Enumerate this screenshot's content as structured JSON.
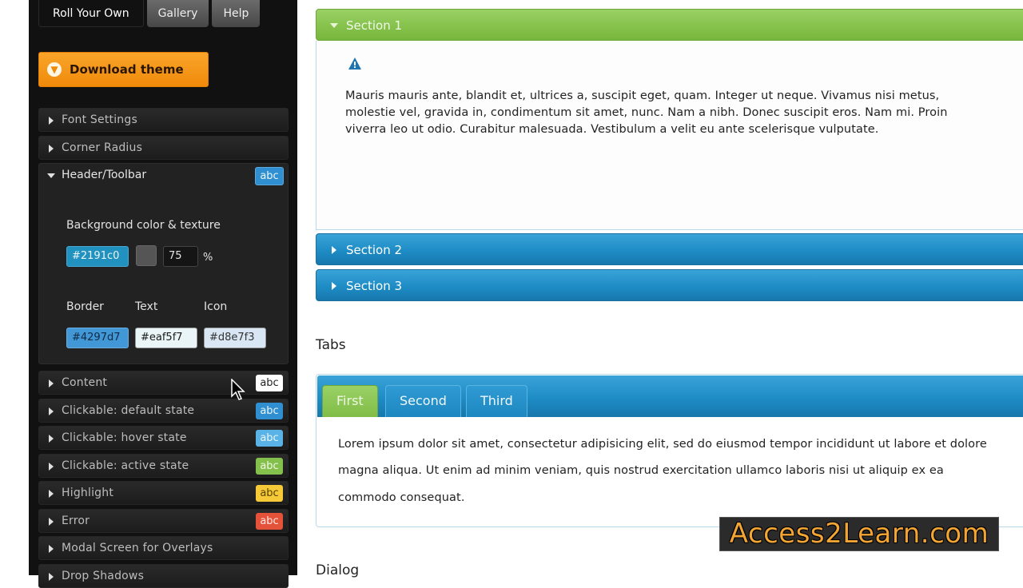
{
  "panel": {
    "tabs": [
      {
        "label": "Roll Your Own"
      },
      {
        "label": "Gallery"
      },
      {
        "label": "Help"
      }
    ],
    "download_label": "Download theme",
    "items": [
      {
        "label": "Font Settings"
      },
      {
        "label": "Corner Radius"
      },
      {
        "label": "Content",
        "badge": "abc",
        "badge_bg": "#ffffff",
        "badge_fg": "#222222"
      },
      {
        "label": "Clickable: default state",
        "badge": "abc",
        "badge_bg": "#2f8fd0",
        "badge_fg": "#eaf5f7"
      },
      {
        "label": "Clickable: hover state",
        "badge": "abc",
        "badge_bg": "#5ab3e6",
        "badge_fg": "#eaf5f7"
      },
      {
        "label": "Clickable: active state",
        "badge": "abc",
        "badge_bg": "#84c04c",
        "badge_fg": "#f0f8e2"
      },
      {
        "label": "Highlight",
        "badge": "abc",
        "badge_bg": "#f5c938",
        "badge_fg": "#5a4200"
      },
      {
        "label": "Error",
        "badge": "abc",
        "badge_bg": "#e5523a",
        "badge_fg": "#ffe8e3"
      },
      {
        "label": "Modal Screen for Overlays"
      },
      {
        "label": "Drop Shadows"
      }
    ],
    "header_toolbar": {
      "label": "Header/Toolbar",
      "badge": "abc",
      "bg_label": "Background color & texture",
      "bg_color": "#2191c0",
      "opacity": "75",
      "percent": "%",
      "border_label": "Border",
      "text_label": "Text",
      "icon_label": "Icon",
      "border_color": "#4297d7",
      "text_color": "#eaf5f7",
      "icon_color": "#d8e7f3"
    }
  },
  "accordion": {
    "sections": [
      {
        "label": "Section 1"
      },
      {
        "label": "Section 2"
      },
      {
        "label": "Section 3"
      }
    ],
    "content_lines": [
      "Mauris mauris ante, blandit et, ultrices a, suscipit eget, quam. Integer ut neque. Vivamus nisi metus,",
      "molestie vel, gravida in, condimentum sit amet, nunc. Nam a nibh. Donec suscipit eros. Nam mi. Proin",
      "viverra leo ut odio. Curabitur malesuada. Vestibulum a velit eu ante scelerisque vulputate."
    ]
  },
  "tabs_section": {
    "heading": "Tabs",
    "tabs": [
      {
        "label": "First"
      },
      {
        "label": "Second"
      },
      {
        "label": "Third"
      }
    ],
    "content_lines": [
      "Lorem ipsum dolor sit amet, consectetur adipisicing elit, sed do eiusmod tempor incididunt ut labore et dolore",
      "magna aliqua. Ut enim ad minim veniam, quis nostrud exercitation ullamco laboris nisi ut aliquip ex ea",
      "commodo consequat."
    ]
  },
  "dialog_heading": "Dialog",
  "watermark": "Access2Learn.com",
  "colors": {
    "accent_green": "#86c24d",
    "accent_blue": "#1e8cc5",
    "download_orange": "#f5981a",
    "panel_bg": "#111111"
  }
}
